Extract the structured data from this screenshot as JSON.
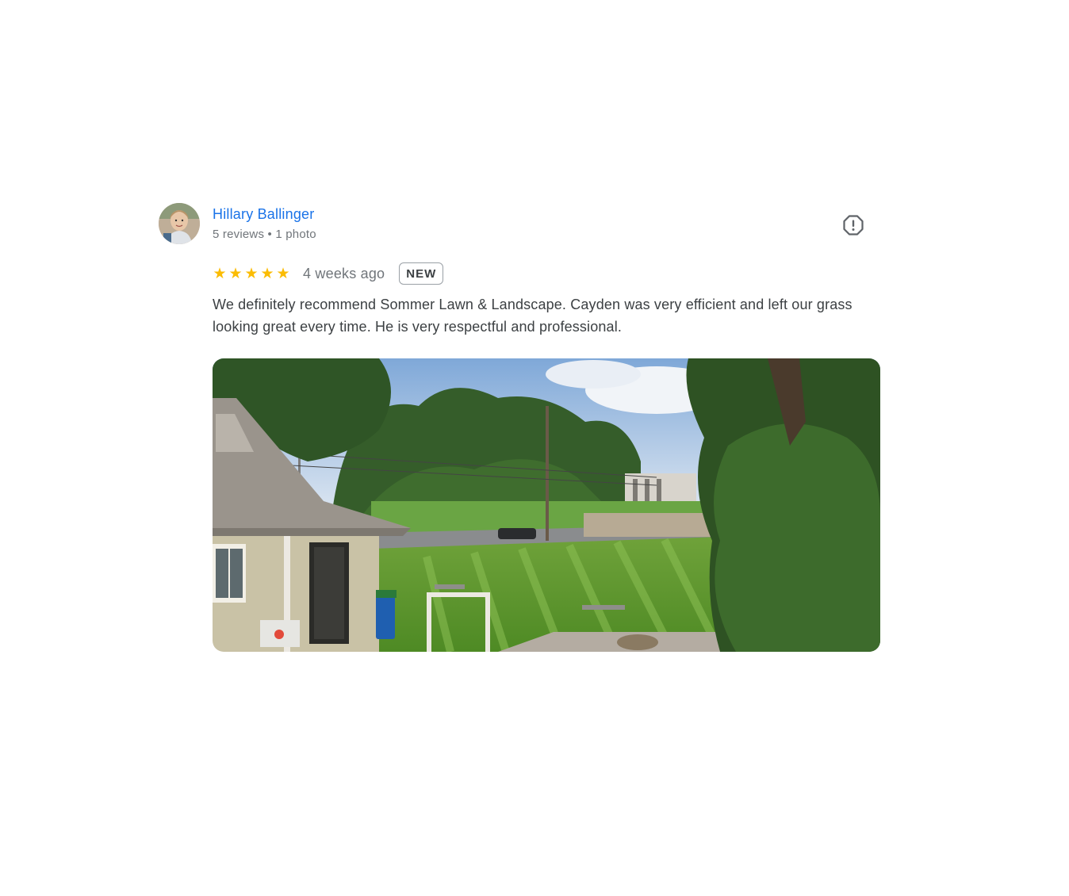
{
  "reviewer": {
    "name": "Hillary Ballinger",
    "meta": "5 reviews • 1 photo",
    "avatar_icon": "user-avatar"
  },
  "rating": {
    "stars": 5,
    "star_glyph": "★",
    "time_ago": "4 weeks ago",
    "badge": "NEW"
  },
  "review": {
    "text": "We definitely recommend Sommer Lawn & Landscape. Cayden was very efficient and left our grass looking great every time. He is very respectful and professional."
  },
  "photo": {
    "subject": "mowed-lawn-photo"
  },
  "icons": {
    "report": "report-flag-icon"
  },
  "colors": {
    "name_link": "#1a73e8",
    "star": "#fbbc04",
    "muted_text": "#70757a",
    "body_text": "#3c4043"
  }
}
